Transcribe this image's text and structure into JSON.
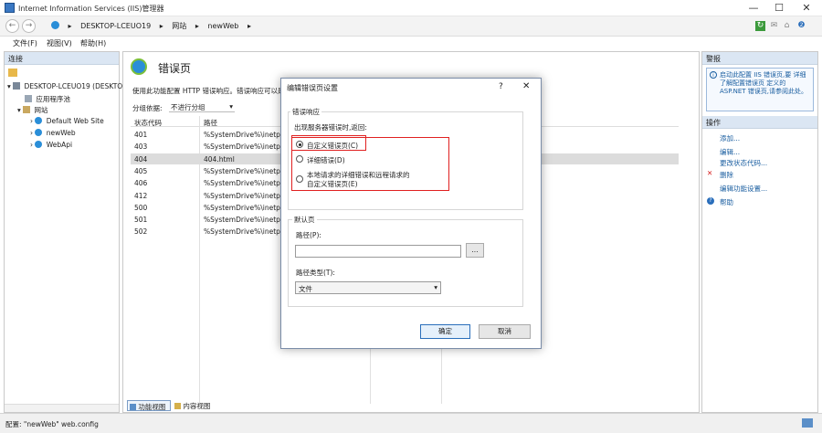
{
  "window": {
    "title": "Internet Information Services (IIS)管理器",
    "minimize": "—",
    "maximize": "☐",
    "close": "✕"
  },
  "address": {
    "back": "←",
    "forward": "→",
    "crumbs": [
      "DESKTOP-LCEUO19",
      "网站",
      "newWeb"
    ]
  },
  "menu": {
    "file": "文件(F)",
    "view": "视图(V)",
    "help": "帮助(H)"
  },
  "connections": {
    "header": "连接",
    "tree": {
      "server": "DESKTOP-LCEUO19 (DESKTOP",
      "app_pools": "应用程序池",
      "sites": "网站",
      "default_site": "Default Web Site",
      "new_web": "newWeb",
      "webapi": "WebApi"
    }
  },
  "feature": {
    "title": "错误页",
    "description": "使用此功能配置 HTTP 错误响应。错误响应可以是",
    "group_label": "分组依据:",
    "group_value": "不进行分组",
    "columns": [
      "状态代码",
      "路径"
    ],
    "rows": [
      {
        "code": "401",
        "path": "%SystemDrive%\\inetp..."
      },
      {
        "code": "403",
        "path": "%SystemDrive%\\inetp..."
      },
      {
        "code": "404",
        "path": "404.html"
      },
      {
        "code": "405",
        "path": "%SystemDrive%\\inetp..."
      },
      {
        "code": "406",
        "path": "%SystemDrive%\\inetp..."
      },
      {
        "code": "412",
        "path": "%SystemDrive%\\inetp..."
      },
      {
        "code": "500",
        "path": "%SystemDrive%\\inetp..."
      },
      {
        "code": "501",
        "path": "%SystemDrive%\\inetp..."
      },
      {
        "code": "502",
        "path": "%SystemDrive%\\inetp..."
      }
    ],
    "tab_features": "功能视图",
    "tab_content": "内容视图"
  },
  "dialog": {
    "title": "编辑错误页设置",
    "help": "?",
    "close": "✕",
    "group_error_response": "错误响应",
    "question": "出现服务器错误时,返回:",
    "option_custom": "自定义错误页(C)",
    "option_detailed": "详细错误(D)",
    "option_local_detailed_line1": "本地请求的详细错误和远程请求的",
    "option_local_detailed_line2": "自定义错误页(E)",
    "group_default_page": "默认页",
    "path_label": "路径(P):",
    "path_value": "",
    "browse": "...",
    "path_type_label": "路径类型(T):",
    "path_type_value": "文件",
    "ok": "确定",
    "cancel": "取消"
  },
  "alerts": {
    "header": "警报",
    "text": "启动此配置 IIS 错误页,要 详细了解配置错误页 定义的 ASP.NET 错误页,请参阅此处。"
  },
  "actions": {
    "header": "操作",
    "items": [
      "添加...",
      "编辑...",
      "更改状态代码...",
      "删除",
      "编辑功能设置...",
      "帮助"
    ]
  },
  "status": {
    "text": "配置: \"newWeb\" web.config"
  }
}
